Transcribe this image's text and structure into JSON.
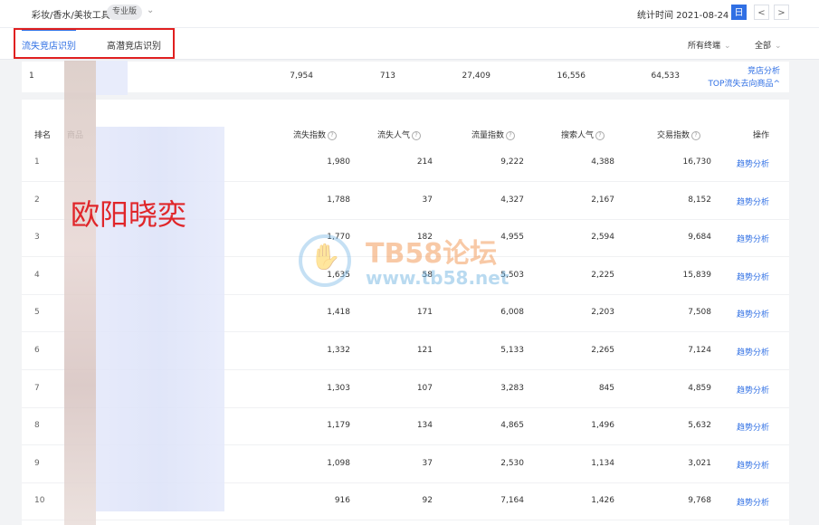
{
  "header": {
    "breadcrumb": "彩妆/香水/美妆工具",
    "edition_badge": "专业版",
    "stat_label": "统计时间 2021-08-24",
    "date_mode": "日",
    "prev": "<",
    "next": ">"
  },
  "tabs": [
    {
      "label": "流失竞店识别",
      "active": true
    },
    {
      "label": "高潜竞店识别",
      "active": false
    }
  ],
  "filters": {
    "terminal": "所有终端",
    "scope": "全部"
  },
  "summary": {
    "rank": "1",
    "values": [
      "7,954",
      "713",
      "27,409",
      "16,556",
      "64,533"
    ],
    "link_analysis": "竞店分析",
    "link_top": "TOP流失去向商品^"
  },
  "table": {
    "columns": [
      "排名",
      "商品",
      "流失指数",
      "流失人气",
      "流量指数",
      "搜索人气",
      "交易指数",
      "操作"
    ],
    "rows": [
      {
        "rank": "1",
        "v": [
          "1,980",
          "214",
          "9,222",
          "4,388",
          "16,730"
        ],
        "op": "趋势分析"
      },
      {
        "rank": "2",
        "v": [
          "1,788",
          "37",
          "4,327",
          "2,167",
          "8,152"
        ],
        "op": "趋势分析"
      },
      {
        "rank": "3",
        "v": [
          "1,770",
          "182",
          "4,955",
          "2,594",
          "9,684"
        ],
        "op": "趋势分析"
      },
      {
        "rank": "4",
        "v": [
          "1,635",
          "58",
          "5,503",
          "2,225",
          "15,839"
        ],
        "op": "趋势分析"
      },
      {
        "rank": "5",
        "v": [
          "1,418",
          "171",
          "6,008",
          "2,203",
          "7,508"
        ],
        "op": "趋势分析"
      },
      {
        "rank": "6",
        "v": [
          "1,332",
          "121",
          "5,133",
          "2,265",
          "7,124"
        ],
        "op": "趋势分析"
      },
      {
        "rank": "7",
        "v": [
          "1,303",
          "107",
          "3,283",
          "845",
          "4,859"
        ],
        "op": "趋势分析"
      },
      {
        "rank": "8",
        "v": [
          "1,179",
          "134",
          "4,865",
          "1,496",
          "5,632"
        ],
        "op": "趋势分析"
      },
      {
        "rank": "9",
        "v": [
          "1,098",
          "37",
          "2,530",
          "1,134",
          "3,021"
        ],
        "op": "趋势分析"
      },
      {
        "rank": "10",
        "v": [
          "916",
          "92",
          "7,164",
          "1,426",
          "9,768"
        ],
        "op": "趋势分析"
      }
    ]
  },
  "overlays": {
    "name_mark": "欧阳晓奕",
    "site_name": "TB58论坛",
    "site_url": "www.tb58.net"
  },
  "colors": {
    "accent": "#2f6fe4",
    "highlight_box": "#e02020"
  },
  "icons": {
    "dropdown": "chevron-down-icon",
    "help": "question-circle-icon"
  }
}
